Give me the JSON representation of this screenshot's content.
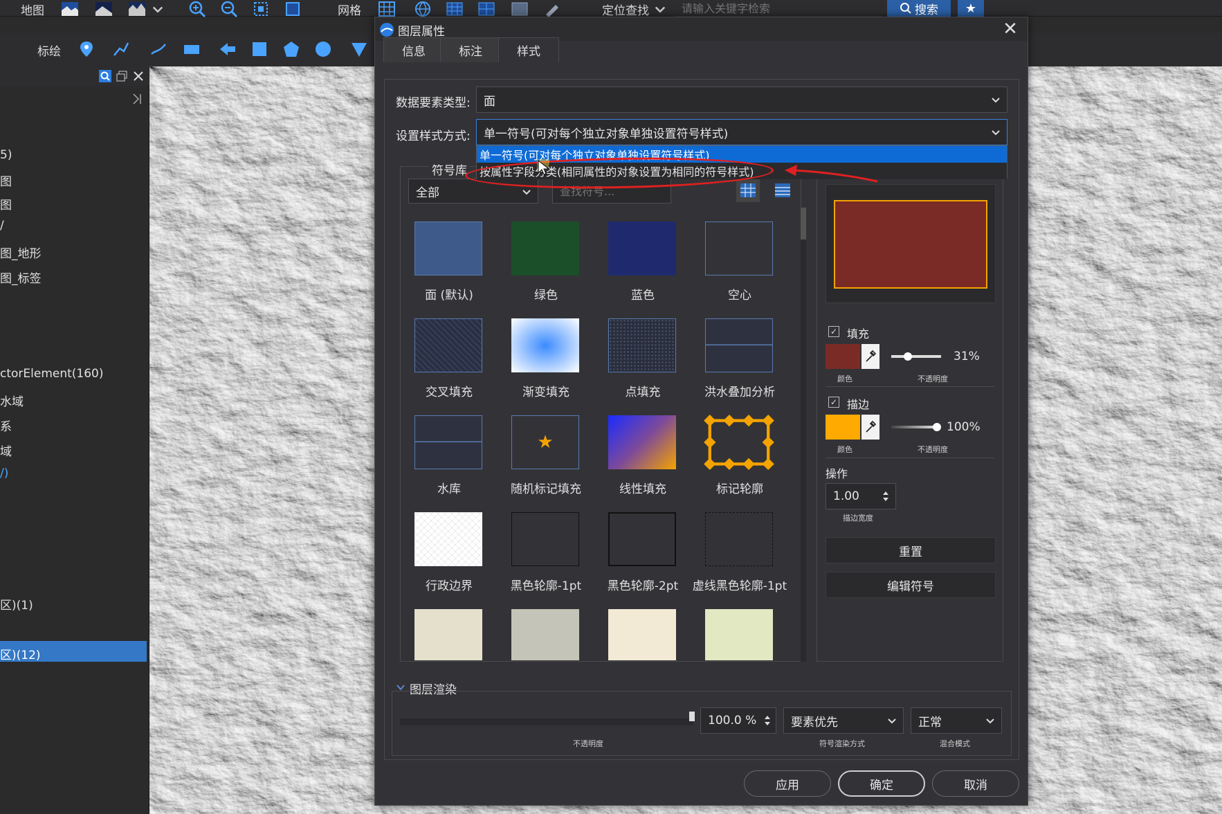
{
  "toolbar": {
    "map_label": "地图",
    "grid_label": "网格",
    "locate_label": "定位查找",
    "search_placeholder": "请输入关键字检索",
    "search_button": "搜索",
    "plot_label": "标绘"
  },
  "left_panel": {
    "items": [
      "5)",
      "图",
      "图",
      "/",
      "图_地形",
      "图_标签",
      "ctorElement(160)",
      "水域",
      "系",
      "域",
      "",
      "区)(1)",
      "区)(12)"
    ]
  },
  "dialog": {
    "title": "图层属性",
    "close": "✕",
    "tabs": [
      {
        "label": "信息"
      },
      {
        "label": "标注"
      },
      {
        "label": "样式"
      }
    ],
    "data_type_label": "数据要素类型:",
    "data_type_value": "面",
    "style_mode_label": "设置样式方式:",
    "style_mode_value": "单一符号(可对每个独立对象单独设置符号样式)",
    "dropdown_options": [
      "单一符号(可对每个独立对象单独设置符号样式)",
      "按属性字段分类(相同属性的对象设置为相同的符号样式)"
    ],
    "library_label": "符号库",
    "filter_value": "全部",
    "symbol_search_placeholder": "查找符号...",
    "symbols": [
      {
        "label": "面 (默认)"
      },
      {
        "label": "绿色"
      },
      {
        "label": "蓝色"
      },
      {
        "label": "空心"
      },
      {
        "label": "交叉填充"
      },
      {
        "label": "渐变填充"
      },
      {
        "label": "点填充"
      },
      {
        "label": "洪水叠加分析"
      },
      {
        "label": "水库"
      },
      {
        "label": "随机标记填充"
      },
      {
        "label": "线性填充"
      },
      {
        "label": "标记轮廓"
      },
      {
        "label": "行政边界"
      },
      {
        "label": "黑色轮廓-1pt"
      },
      {
        "label": "黑色轮廓-2pt"
      },
      {
        "label": "虚线黑色轮廓-1pt"
      },
      {
        "label": ""
      },
      {
        "label": ""
      },
      {
        "label": ""
      },
      {
        "label": ""
      }
    ],
    "fill": {
      "label": "填充",
      "color_caption": "颜色",
      "opacity_caption": "不透明度",
      "opacity": "31%",
      "opacity_value": 0.31,
      "color": "#7b2b26"
    },
    "stroke": {
      "label": "描边",
      "color_caption": "颜色",
      "opacity_caption": "不透明度",
      "opacity": "100%",
      "opacity_value": 1.0,
      "color": "#ffaa00"
    },
    "operation_label": "操作",
    "stroke_width": "1.00",
    "stroke_width_caption": "描边宽度",
    "reset_button": "重置",
    "edit_symbol_button": "编辑符号",
    "render": {
      "header": "图层渲染",
      "opacity": "100.0 %",
      "opacity_caption": "不透明度",
      "symbol_render_mode": "要素优先",
      "symbol_render_caption": "符号渲染方式",
      "blend_mode": "正常",
      "blend_caption": "混合模式"
    },
    "apply_button": "应用",
    "ok_button": "确定",
    "cancel_button": "取消"
  },
  "colors": {
    "accent": "#0e6bd6",
    "selection": "#3478c6",
    "annotation": "#e02020"
  }
}
